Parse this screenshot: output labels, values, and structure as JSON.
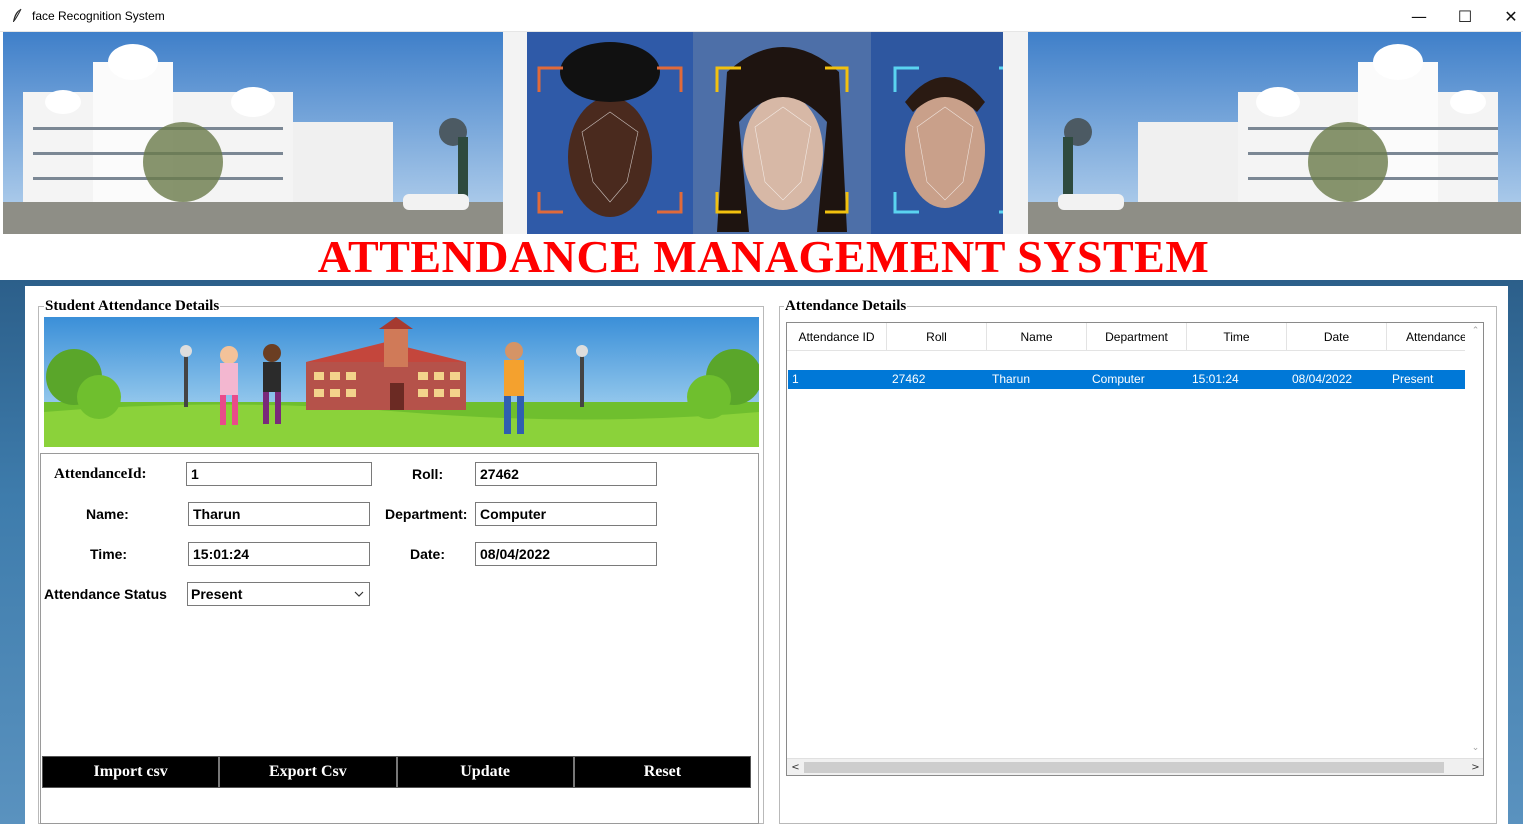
{
  "window": {
    "title": "face Recognition System",
    "controls": {
      "minimize": "—",
      "maximize": "☐",
      "close": "✕"
    }
  },
  "header": {
    "title": "ATTENDANCE MANAGEMENT SYSTEM",
    "title_color": "#ff0000"
  },
  "left_panel": {
    "title": "Student Attendance Details",
    "form": {
      "attendance_id_label": "AttendanceId:",
      "attendance_id_value": "1",
      "roll_label": "Roll:",
      "roll_value": "27462",
      "name_label": "Name:",
      "name_value": "Tharun",
      "department_label": "Department:",
      "department_value": "Computer",
      "time_label": "Time:",
      "time_value": "15:01:24",
      "date_label": "Date:",
      "date_value": "08/04/2022",
      "status_label": "Attendance Status",
      "status_value": "Present"
    },
    "buttons": {
      "import": "Import csv",
      "export": "Export Csv",
      "update": "Update",
      "reset": "Reset"
    }
  },
  "right_panel": {
    "title": "Attendance Details",
    "table": {
      "columns": [
        "Attendance ID",
        "Roll",
        "Name",
        "Department",
        "Time",
        "Date",
        "Attendance"
      ],
      "rows": [
        [
          "1",
          "27462",
          "Tharun",
          "Computer",
          "15:01:24",
          "08/04/2022",
          "Present"
        ]
      ],
      "selected_row_color": "#0078d7"
    },
    "scrollbar": {
      "up": "⌃",
      "down": "⌄",
      "left": "<",
      "right": ">"
    }
  },
  "icons": [
    "feather-icon",
    "chevron-down-icon"
  ]
}
